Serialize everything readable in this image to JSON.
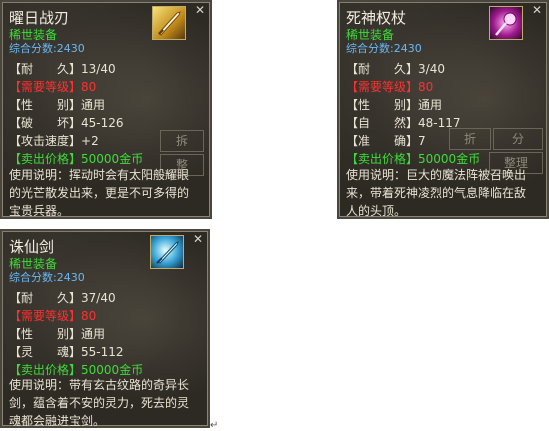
{
  "tooltips": [
    {
      "name": "曜日战刃",
      "quality": "稀世装备",
      "score": "综合分数:2430",
      "icon": "sword-icon",
      "rows": [
        {
          "key": "【耐　　久】",
          "value": "13/40",
          "style": "white"
        },
        {
          "key": "【需要等级】",
          "value": "80",
          "style": "red"
        },
        {
          "key": "【性　　别】",
          "value": "通用",
          "style": "white"
        },
        {
          "key": "【破　　坏】",
          "value": "45-126",
          "style": "white"
        },
        {
          "key": "【攻击速度】",
          "value": "+2",
          "style": "white"
        },
        {
          "key": "【卖出价格】",
          "value": "50000金币",
          "style": "green"
        }
      ],
      "desc_line1": "使用说明：挥动时会有太阳般耀眼",
      "desc_line2": "的光芒散发出来，更是不可多得的",
      "desc_line3": "宝贵兵器。",
      "ghost_button1": "拆",
      "ghost_button2": "整"
    },
    {
      "name": "死神权杖",
      "quality": "稀世装备",
      "score": "综合分数:2430",
      "icon": "scepter-icon",
      "rows": [
        {
          "key": "【耐　　久】",
          "value": "3/40",
          "style": "white"
        },
        {
          "key": "【需要等级】",
          "value": "80",
          "style": "red"
        },
        {
          "key": "【性　　别】",
          "value": "通用",
          "style": "white"
        },
        {
          "key": "【自　　然】",
          "value": "48-117",
          "style": "white"
        },
        {
          "key": "【准　　确】",
          "value": "7",
          "style": "white"
        },
        {
          "key": "【卖出价格】",
          "value": "50000金币",
          "style": "green"
        }
      ],
      "desc_line1": "使用说明：巨大的魔法阵被召唤出",
      "desc_line2": "来，带着死神凌烈的气息降临在敌",
      "desc_line3": "人的头顶。",
      "ghost_button1": "折",
      "ghost_button2": "分",
      "ghost_button3": "整理"
    },
    {
      "name": "诛仙剑",
      "quality": "稀世装备",
      "score": "综合分数:2430",
      "icon": "sword-icon",
      "rows": [
        {
          "key": "【耐　　久】",
          "value": "37/40",
          "style": "white"
        },
        {
          "key": "【需要等级】",
          "value": "80",
          "style": "red"
        },
        {
          "key": "【性　　别】",
          "value": "通用",
          "style": "white"
        },
        {
          "key": "【灵　　魂】",
          "value": "55-112",
          "style": "white"
        },
        {
          "key": "【卖出价格】",
          "value": "50000金币",
          "style": "green"
        }
      ],
      "desc_line1": "使用说明：带有玄古纹路的奇异长",
      "desc_line2": "剑，蕴含着不安的灵力，死去的灵",
      "desc_line3": "魂都会融进宝剑。"
    }
  ],
  "colors": {
    "panel_bg": "#2d2a24",
    "quality_green": "#3ddc39",
    "score_blue": "#69b8f5",
    "required_red": "#ff3030"
  }
}
